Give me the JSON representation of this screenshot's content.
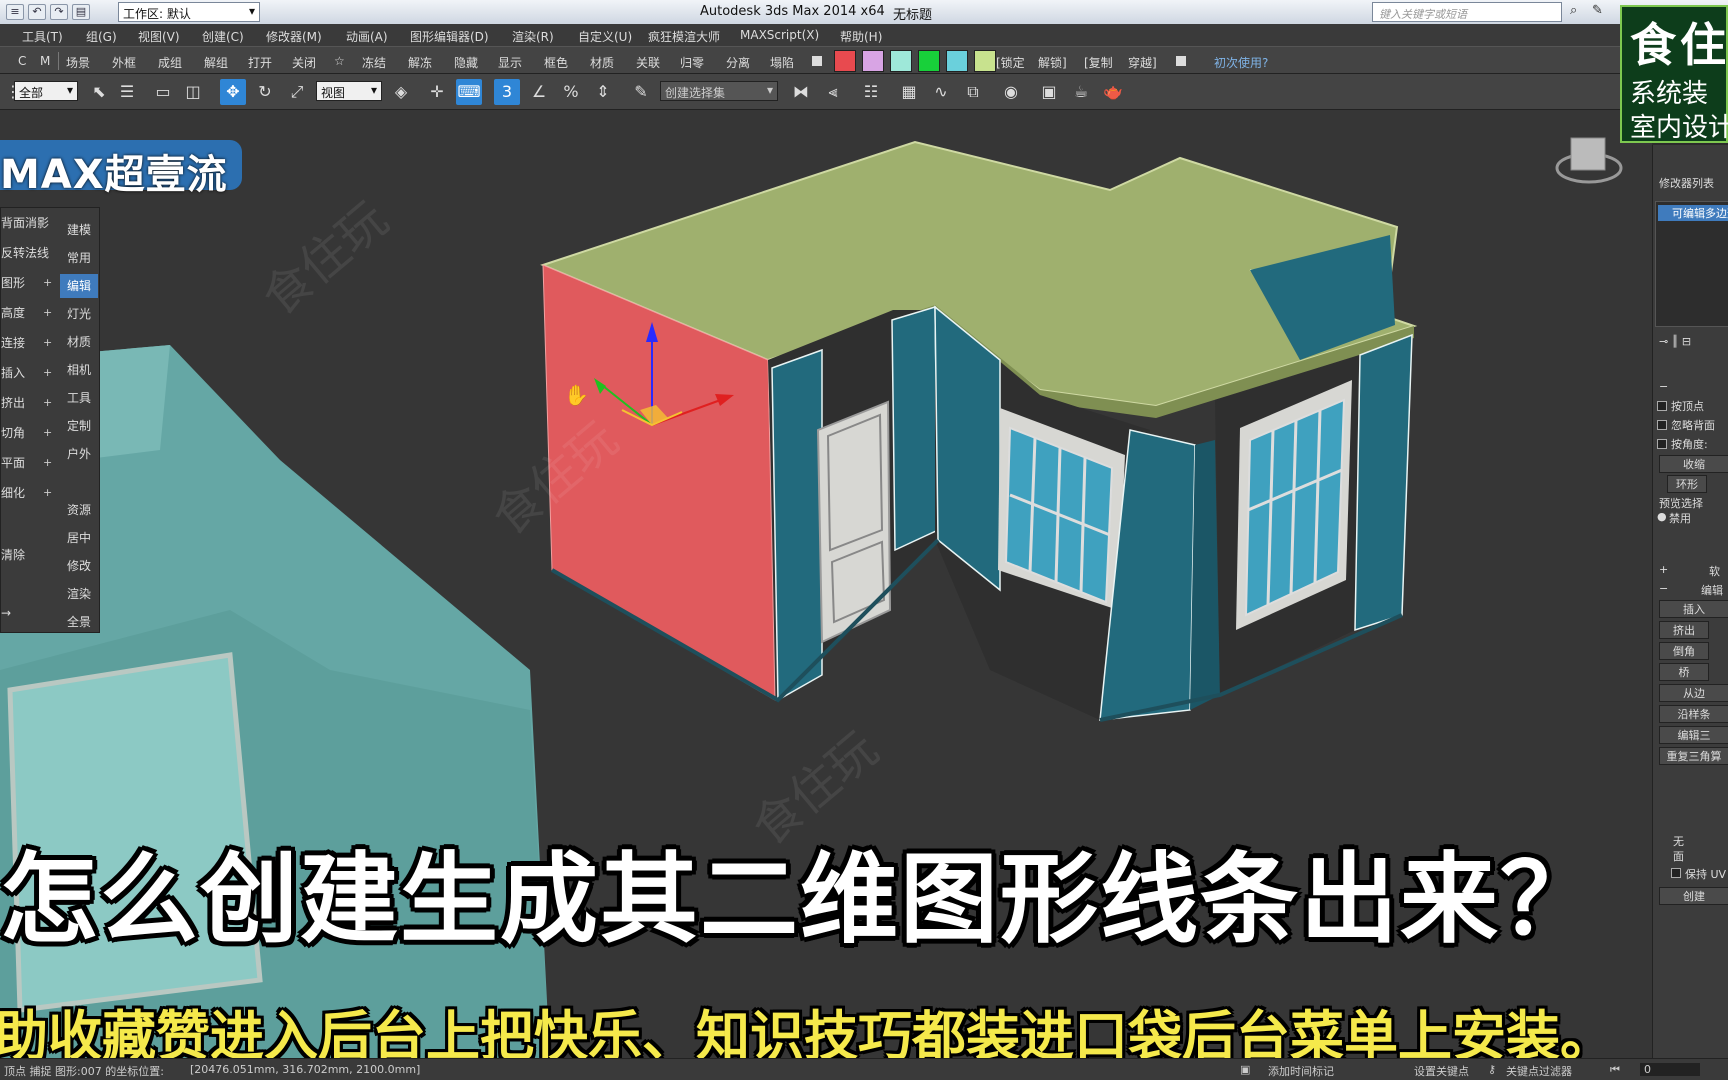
{
  "titlebar": {
    "workspace": "工作区: 默认",
    "app_title": "Autodesk 3ds Max  2014 x64",
    "doc_title": "无标题",
    "search_placeholder": "键入关键字或短语"
  },
  "menu": [
    "工具(T)",
    "组(G)",
    "视图(V)",
    "创建(C)",
    "修改器(M)",
    "动画(A)",
    "图形编辑器(D)",
    "渲染(R)",
    "自定义(U)",
    "疯狂模渲大师",
    "MAXScript(X)",
    "帮助(H)"
  ],
  "plugin_toolbar": {
    "left_letters": [
      "C",
      "M"
    ],
    "items": [
      "场景",
      "外框",
      "成组",
      "解组",
      "打开",
      "关闭",
      "☆",
      "冻结",
      "解冻",
      "隐藏",
      "显示",
      "框色",
      "材质",
      "关联",
      "归零",
      "分离",
      "塌陷"
    ],
    "right_items": [
      "[锁定",
      "解锁]",
      "[复制",
      "穿越]"
    ],
    "help": "初次使用?",
    "swatch_colors": [
      "#e84a4f",
      "#d8a4e4",
      "#9ee8d9",
      "#18d03a",
      "#6ad0dc",
      "#c8e28e"
    ]
  },
  "main_toolbar": {
    "selection_filter": "全部",
    "ref_coord": "视图",
    "named_selection": "创建选择集",
    "snap_label": "3"
  },
  "brand": {
    "badge": "MAX超壹流",
    "right_big": "食住",
    "right_l1": "系统装",
    "right_l2": "室内设计"
  },
  "left_panel": {
    "rows": [
      {
        "label": "背面消影",
        "plus": ""
      },
      {
        "label": "反转法线",
        "plus": ""
      },
      {
        "label": "图形",
        "plus": "+"
      },
      {
        "label": "高度",
        "plus": "+"
      },
      {
        "label": "连接",
        "plus": "+"
      },
      {
        "label": "插入",
        "plus": "+"
      },
      {
        "label": "挤出",
        "plus": "+"
      },
      {
        "label": "切角",
        "plus": "+"
      },
      {
        "label": "平面",
        "plus": "+"
      },
      {
        "label": "细化",
        "plus": "+"
      },
      {
        "label": "清除",
        "plus": ""
      },
      {
        "label": "→",
        "plus": ""
      }
    ],
    "tabs": [
      "建模",
      "常用",
      "编辑",
      "灯光",
      "材质",
      "相机",
      "工具",
      "定制",
      "户外",
      "资源",
      "居中",
      "修改",
      "渲染",
      "全景"
    ],
    "active_tab": "编辑"
  },
  "command_panel": {
    "modifier_list": "修改器列表",
    "stack_item": "可编辑多边形",
    "opt1": "按顶点",
    "opt2": "忽略背面",
    "opt3": "按角度:",
    "shrink": "收缩",
    "ring": "环形",
    "preview": "预览选择",
    "disabled": "禁用",
    "soft": "软",
    "edit": "编辑",
    "insert": "插入",
    "extrude": "挤出",
    "bevel": "倒角",
    "bridge": "桥",
    "from_edge": "从边",
    "along_spline": "沿样条",
    "edit_tri": "编辑三",
    "retri": "重复三角算",
    "none": "无",
    "face": "面",
    "keep_uv": "保持 UV",
    "create": "创建"
  },
  "status": {
    "left": "顶点 捕捉 图形:007 的坐标位置:",
    "coords": "[20476.051mm, 316.702mm, 2100.0mm]",
    "add_time_tag": "添加时间标记",
    "set_key": "设置关键点",
    "key_filter": "关键点过滤器",
    "frame": "0"
  },
  "captions": {
    "main": "怎么创建生成其二维图形线条出来？",
    "sub": "助收藏赞进入后台上把快乐、知识技巧都装进口袋后台菜单上安装。"
  },
  "watermark": "食住玩",
  "colors": {
    "roof": "#9fb06e",
    "wall_teal": "#226a7d",
    "wall_selected": "#e05a5d",
    "viewport_bg": "#363636",
    "accent_blue": "#2f86d6"
  }
}
